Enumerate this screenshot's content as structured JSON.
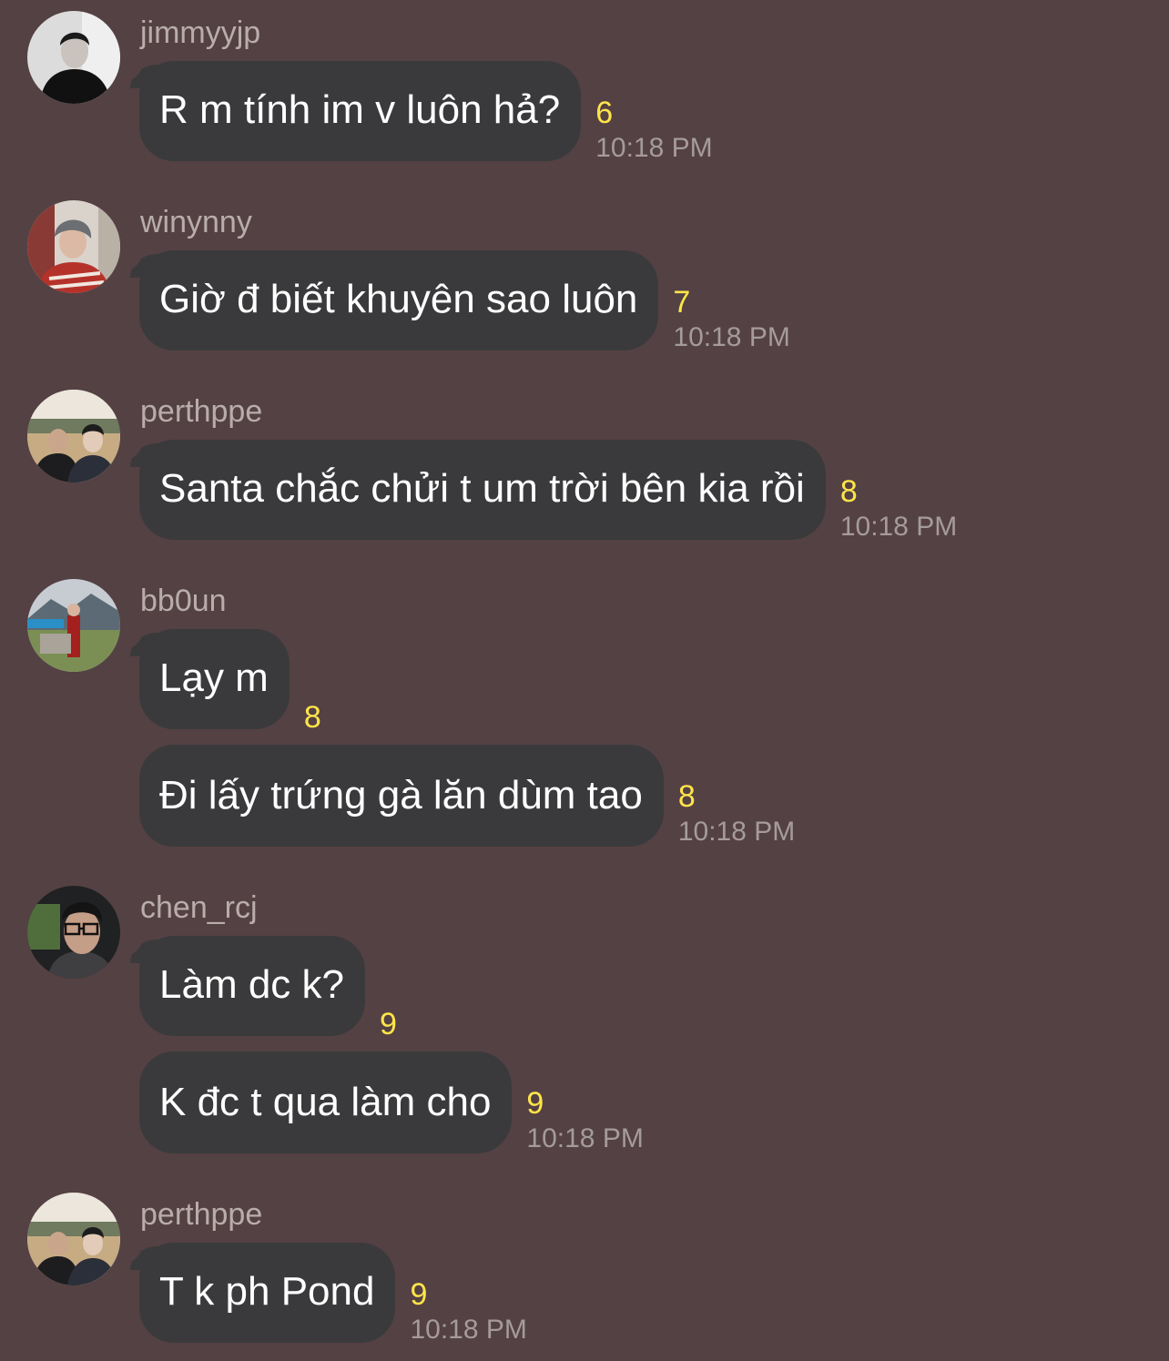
{
  "messages": [
    {
      "username": "jimmyyjp",
      "avatar": "avatar-jimmyyjp",
      "bubbles": [
        {
          "text": "R m tính im v luôn hả?",
          "read_count": "6",
          "time": "10:18 PM"
        }
      ]
    },
    {
      "username": "winynny",
      "avatar": "avatar-winynny",
      "bubbles": [
        {
          "text": "Giờ đ biết khuyên sao luôn",
          "read_count": "7",
          "time": "10:18 PM"
        }
      ]
    },
    {
      "username": "perthppe",
      "avatar": "avatar-perthppe",
      "bubbles": [
        {
          "text": "Santa chắc chửi t um trời bên kia rồi",
          "read_count": "8",
          "time": "10:18 PM"
        }
      ]
    },
    {
      "username": "bb0un",
      "avatar": "avatar-bb0un",
      "bubbles": [
        {
          "text": "Lạy m",
          "read_count": "8"
        },
        {
          "text": "Đi lấy trứng gà lăn dùm tao",
          "read_count": "8",
          "time": "10:18 PM"
        }
      ]
    },
    {
      "username": "chen_rcj",
      "avatar": "avatar-chen-rcj",
      "bubbles": [
        {
          "text": "Làm dc k?",
          "read_count": "9"
        },
        {
          "text": "K đc t qua làm cho",
          "read_count": "9",
          "time": "10:18 PM"
        }
      ]
    },
    {
      "username": "perthppe",
      "avatar": "avatar-perthppe",
      "bubbles": [
        {
          "text": "T k ph Pond",
          "read_count": "9",
          "time": "10:18 PM"
        }
      ]
    }
  ],
  "colors": {
    "background": "#544143",
    "bubble": "#3a3a3c",
    "read_count": "#ffe54a",
    "timestamp": "#a59b9b",
    "username": "#b9adac"
  }
}
